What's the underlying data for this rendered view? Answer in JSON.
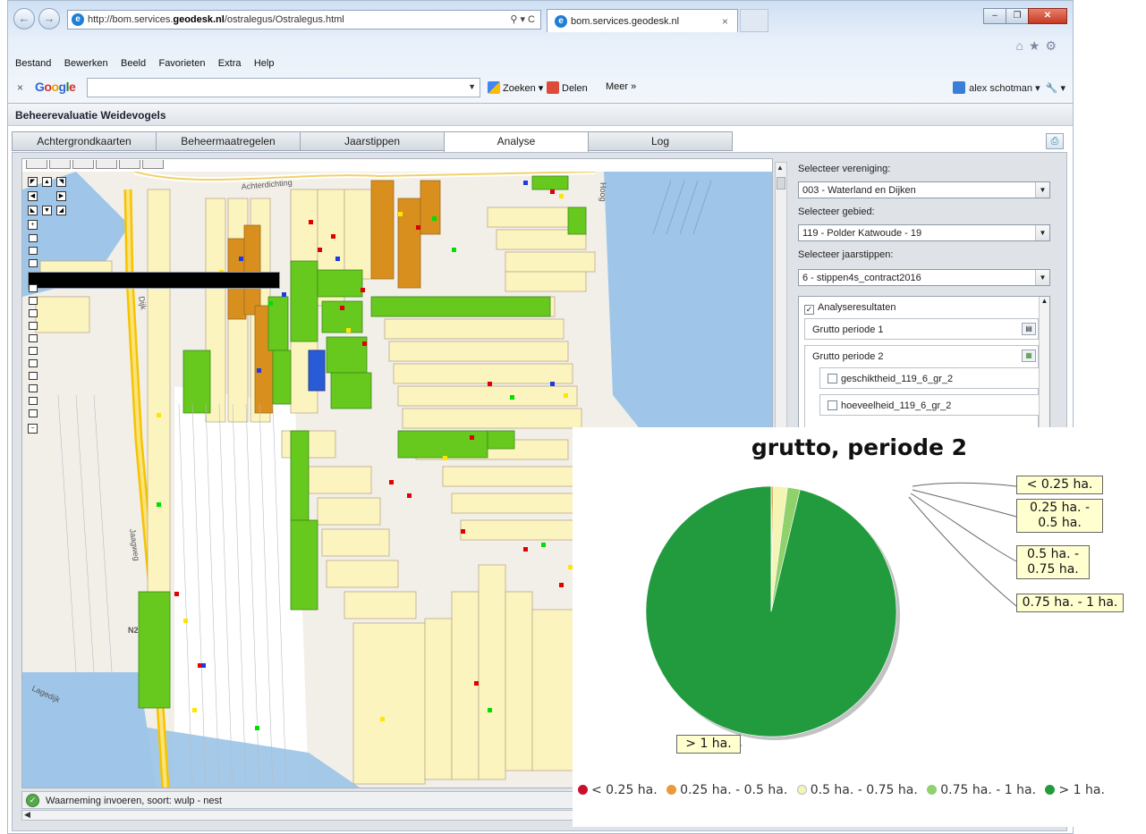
{
  "browser": {
    "url_prefix": "http://bom.services.",
    "url_bold": "geodesk.nl",
    "url_suffix": "/ostralegus/Ostralegus.html",
    "address_tools": "⚲ ▾ C",
    "tab_title": "bom.services.geodesk.nl",
    "menu": [
      "Bestand",
      "Bewerken",
      "Beeld",
      "Favorieten",
      "Extra",
      "Help"
    ],
    "google": {
      "search_label": "Zoeken",
      "share_label": "Delen",
      "more_label": "Meer »",
      "user": "alex schotman"
    }
  },
  "app": {
    "title": "Beheerevaluatie Weidevogels",
    "tabs": [
      "Achtergrondkaarten",
      "Beheermaatregelen",
      "Jaarstippen",
      "Analyse",
      "Log"
    ],
    "active_tab": "Analyse"
  },
  "panel": {
    "vereniging_label": "Selecteer vereniging:",
    "vereniging_value": "003 - Waterland en Dijken",
    "gebied_label": "Selecteer gebied:",
    "gebied_value": "119 - Polder Katwoude - 19",
    "jaarstippen_label": "Selecteer jaarstippen:",
    "jaarstippen_value": "6 - stippen4s_contract2016",
    "results_label": "Analyseresultaten",
    "periode1": "Grutto periode 1",
    "periode2": "Grutto periode 2",
    "layer1": "geschiktheid_119_6_gr_2",
    "layer2": "hoeveelheid_119_6_gr_2"
  },
  "map": {
    "labels": {
      "road1": "Achterdichting",
      "road2": "Jaagweg",
      "road3": "N24",
      "road4": "Lagedijk",
      "road5": "Hoog",
      "road6": "agedijk",
      "road7": "Dijk"
    }
  },
  "status": {
    "text": "Waarneming invoeren, soort: wulp - nest"
  },
  "chart_data": {
    "type": "pie",
    "title": "grutto, periode 2",
    "labels": [
      "< 0.25 ha.",
      "0.25 ha. - 0.5 ha.",
      "0.5 ha. - 0.75 ha.",
      "0.75 ha. - 1 ha.",
      "> 1 ha."
    ],
    "values": [
      0.1,
      0.2,
      1.8,
      1.6,
      96.3
    ],
    "colors": [
      "#c8102e",
      "#e89a3c",
      "#f4f4b4",
      "#8fd16b",
      "#229b3e"
    ],
    "legend_position": "bottom"
  }
}
